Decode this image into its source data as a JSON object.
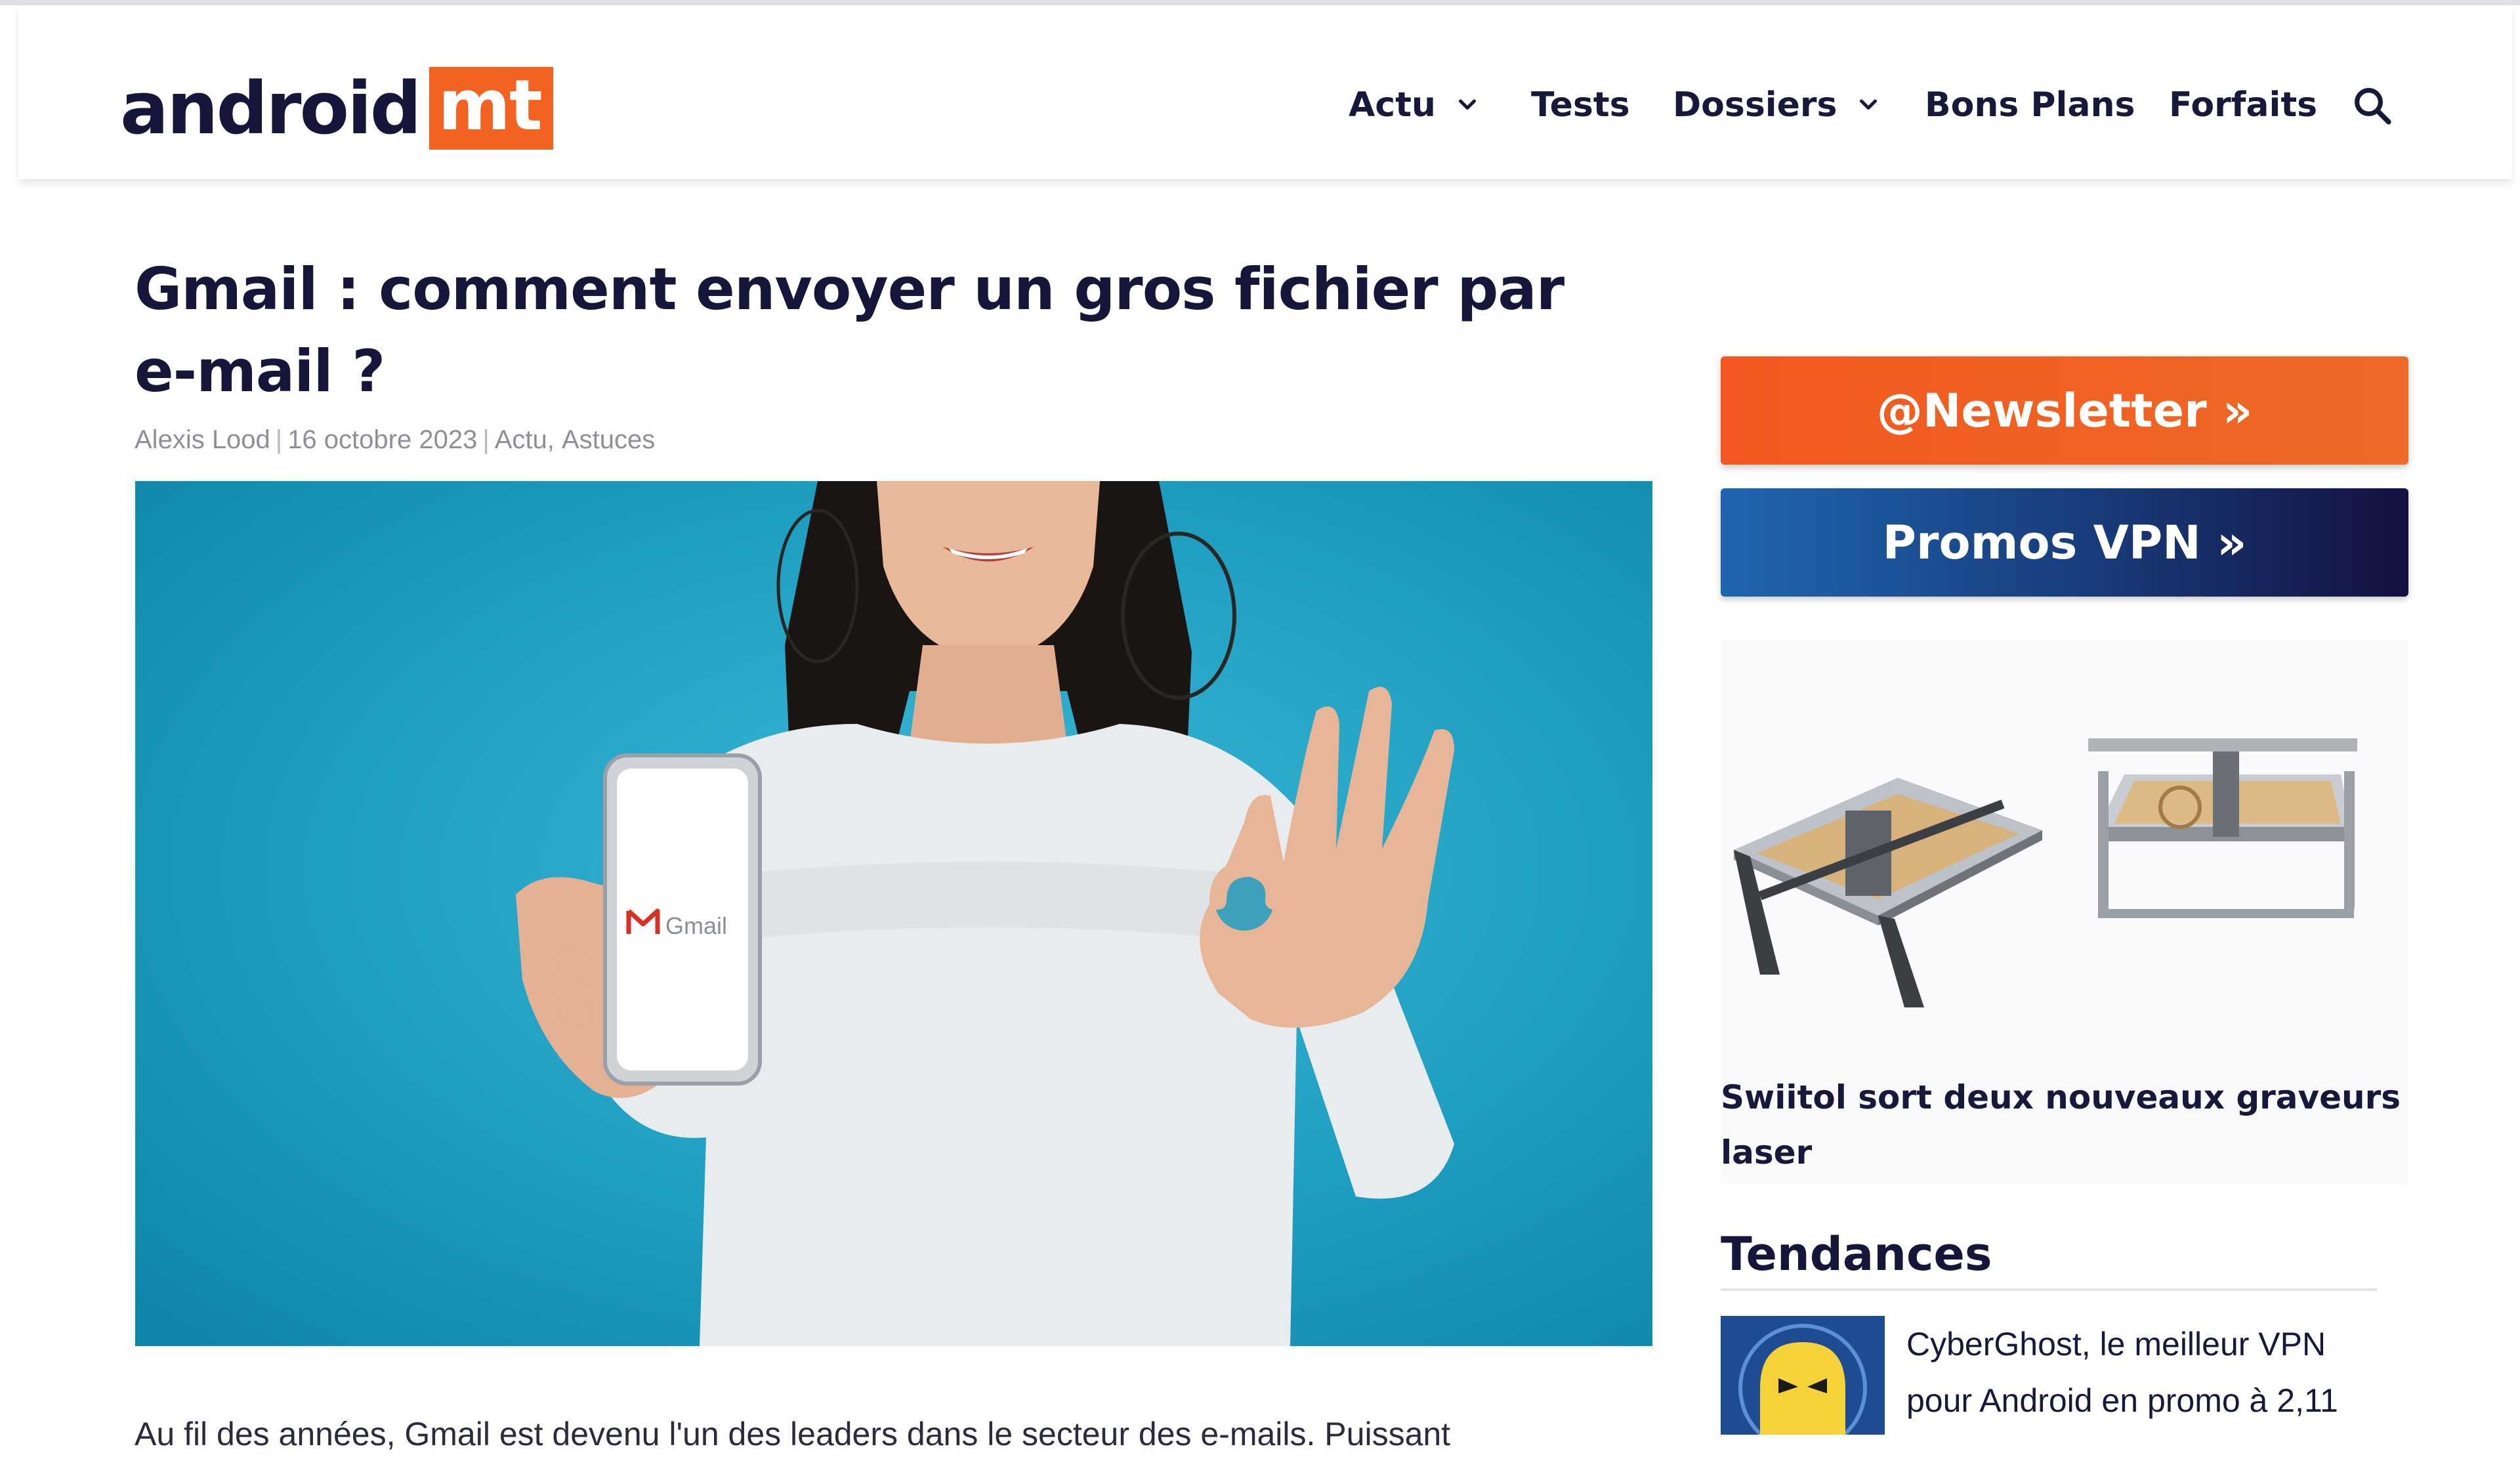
{
  "site": {
    "logo_part1": "android",
    "logo_part2": "mt",
    "brand_color": "#f26322",
    "dark_color": "#15163a"
  },
  "nav": {
    "items": [
      {
        "label": "Actu",
        "has_dropdown": true
      },
      {
        "label": "Tests",
        "has_dropdown": false
      },
      {
        "label": "Dossiers",
        "has_dropdown": true
      },
      {
        "label": "Bons Plans",
        "has_dropdown": false
      },
      {
        "label": "Forfaits",
        "has_dropdown": false
      }
    ],
    "search_icon": "search-icon"
  },
  "article": {
    "title": "Gmail : comment envoyer un gros fichier par e-mail ?",
    "author": "Alexis Lood",
    "date": "16 octobre 2023",
    "categories": [
      "Actu",
      "Astuces"
    ],
    "hero_phone_label": "Gmail",
    "intro": "Au fil des années, Gmail est devenu l'un des leaders dans le secteur des e-mails. Puissant"
  },
  "sidebar": {
    "newsletter_label": "@Newsletter »",
    "vpn_label": "Promos VPN »",
    "promo": {
      "title": "Swiitol sort deux nouveaux graveurs laser"
    },
    "trends": {
      "heading": "Tendances",
      "items": [
        {
          "text": "CyberGhost, le meilleur VPN pour Android en promo à 2,11"
        }
      ]
    }
  }
}
